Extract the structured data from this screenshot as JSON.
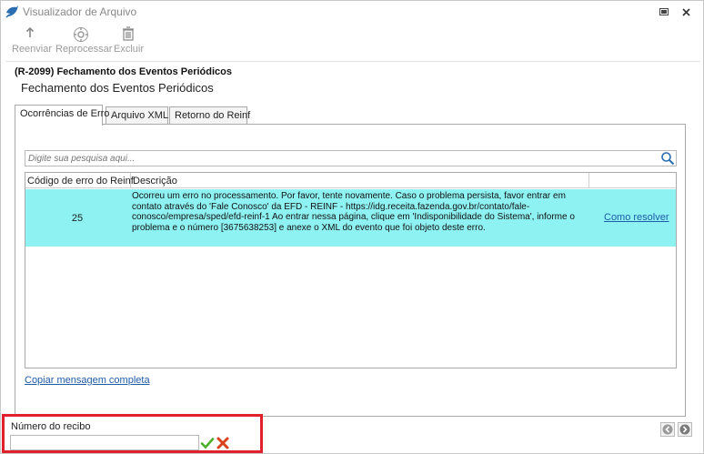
{
  "window": {
    "title": "Visualizador de Arquivo"
  },
  "toolbar": {
    "resend_label": "Reenviar",
    "reprocess_label": "Reprocessar",
    "delete_label": "Excluir"
  },
  "header": {
    "heading": "(R-2099) Fechamento dos Eventos Periódicos",
    "subheading": "Fechamento dos Eventos Periódicos"
  },
  "tabs": [
    {
      "label": "Ocorrências de Erro",
      "active": true
    },
    {
      "label": "Arquivo XML",
      "active": false
    },
    {
      "label": "Retorno do Reinf",
      "active": false
    }
  ],
  "search": {
    "placeholder": "Digite sua pesquisa aqui..."
  },
  "table": {
    "columns": [
      "Código de erro do Reinf",
      "Descrição",
      ""
    ],
    "rows": [
      {
        "code": "25",
        "description": "Ocorreu um erro no processamento. Por favor, tente novamente. Caso o problema persista, favor entrar em contato através do 'Fale Conosco' da EFD - REINF - https://idg.receita.fazenda.gov.br/contato/fale-conosco/empresa/sped/efd-reinf-1 Ao entrar nessa página, clique em 'Indisponibilidade do Sistema', informe o problema e o número [3675638253] e anexe o XML do evento que foi objeto deste erro.",
        "action": "Como resolver"
      }
    ]
  },
  "copy_link": "Copiar mensagem completa",
  "receipt": {
    "label": "Número do recibo",
    "value": ""
  },
  "colors": {
    "row_highlight": "#8ef2f3",
    "link": "#1f5ca8",
    "highlight_border": "#e0202a"
  }
}
